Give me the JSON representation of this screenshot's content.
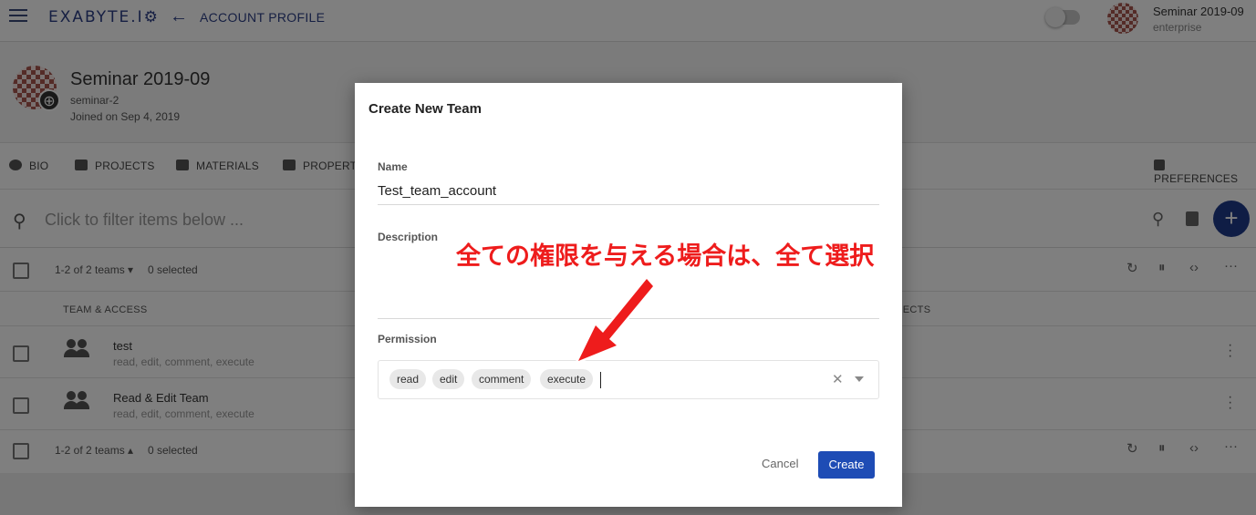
{
  "header": {
    "logo": "EXABYTE.I⚙",
    "back_icon": "arrow-left-icon",
    "page_title": "ACCOUNT PROFILE",
    "user_name": "Seminar 2019-09",
    "user_org": "enterprise"
  },
  "profile": {
    "title": "Seminar 2019-09",
    "handle": "seminar-2",
    "joined": "Joined on Sep 4, 2019"
  },
  "tabs": [
    {
      "label": "BIO",
      "icon": "eye-icon"
    },
    {
      "label": "PROJECTS",
      "icon": "folder-icon"
    },
    {
      "label": "MATERIALS",
      "icon": "widgets-icon"
    },
    {
      "label": "PROPERTI",
      "icon": "property-icon"
    },
    {
      "label": "PREFERENCES",
      "icon": "pencil-icon"
    }
  ],
  "filter": {
    "placeholder": "Click to filter items below ..."
  },
  "list": {
    "count_top": "1-2 of 2 teams ▾",
    "count_bottom": "1-2 of 2 teams ▴",
    "selected": "0 selected",
    "col_team": "TEAM & ACCESS",
    "col_projects": "JECTS",
    "rows": [
      {
        "title": "test",
        "sub": "read, edit, comment, execute"
      },
      {
        "title": "Read & Edit Team",
        "sub": "read, edit, comment, execute"
      }
    ]
  },
  "dialog": {
    "title": "Create New Team",
    "name_label": "Name",
    "name_value": "Test_team_account",
    "description_label": "Description",
    "permission_label": "Permission",
    "chips": [
      "read",
      "edit",
      "comment",
      "execute"
    ],
    "cancel": "Cancel",
    "create": "Create"
  },
  "annotation": {
    "text": "全ての権限を与える場合は、全て選択",
    "color": "#ee1c1c"
  }
}
